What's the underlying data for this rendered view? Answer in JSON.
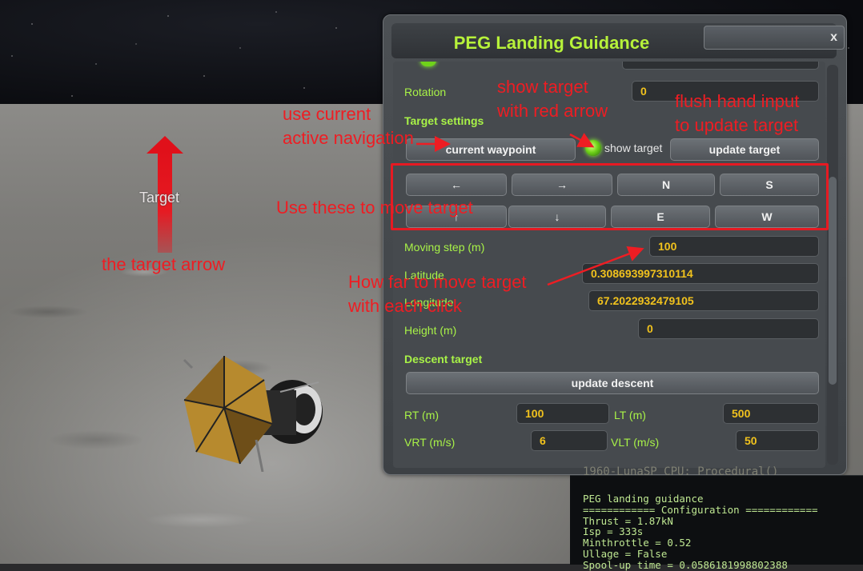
{
  "scene": {
    "target_label": "Target"
  },
  "window": {
    "title": "PEG Landing Guidance",
    "close_label": "x"
  },
  "rotation": {
    "label": "Rotation",
    "value": "0"
  },
  "target_settings": {
    "header": "Target settings",
    "current_waypoint_label": "current waypoint",
    "show_target_label": "show target",
    "update_target_label": "update target"
  },
  "move_buttons": {
    "left": "←",
    "right": "→",
    "north": "N",
    "south": "S",
    "up": "↑",
    "down": "↓",
    "east": "E",
    "west": "W"
  },
  "moving_step": {
    "label": "Moving step (m)",
    "value": "100"
  },
  "latitude": {
    "label": "Latitude",
    "value": "0.308693997310114"
  },
  "longitude": {
    "label": "Longitude",
    "value": "67.2022932479105"
  },
  "height": {
    "label": "Height (m)",
    "value": "0"
  },
  "descent": {
    "header": "Descent target",
    "update_label": "update descent",
    "rt_label": "RT (m)",
    "rt_value": "100",
    "lt_label": "LT (m)",
    "lt_value": "500",
    "vrt_label": "VRT (m/s)",
    "vrt_value": "6",
    "vlt_label": "VLT (m/s)",
    "vlt_value": "50"
  },
  "annotations": {
    "show_target": "show target\nwith red arrow",
    "use_current": "use current\nactive navigation",
    "flush": "flush hand input\nto update target",
    "use_these": "Use these to move target",
    "target_arrow": "the target arrow",
    "how_far": "How far to move target\nwith each click"
  },
  "terminal": {
    "title": "1960-LunaSP CPU: Procedural()",
    "lines": [
      "PEG landing guidance",
      "============ Configuration ============",
      "Thrust = 1.87kN",
      "Isp = 333s",
      "Minthrottle = 0.52",
      "Ullage = False",
      "Spool-up time = 0.0586181998802388"
    ]
  },
  "colors": {
    "accent_green": "#a8f247",
    "value_yellow": "#f1c21d",
    "annotation_red": "#ee1d23"
  }
}
